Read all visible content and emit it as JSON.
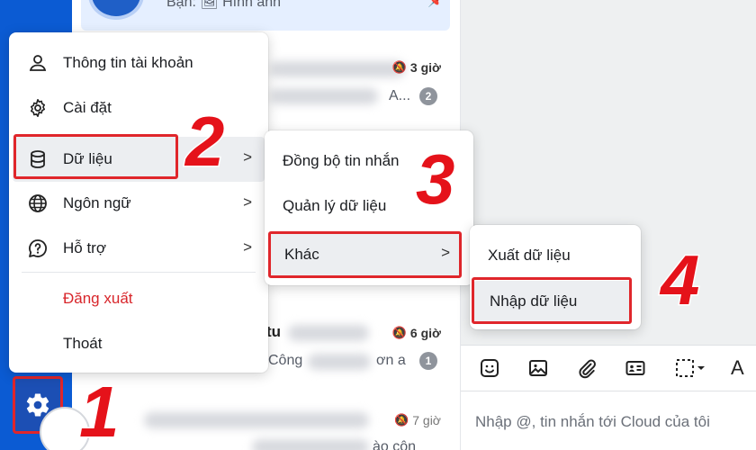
{
  "top_conversation": {
    "preview": "Bạn: 🖼 Hình ảnh",
    "pin_icon": "pin-icon"
  },
  "conversations": [
    {
      "time": "3 giờ",
      "preview": "A...",
      "badge": "2"
    },
    {
      "time": "6 giờ",
      "name_fragment": "tu",
      "preview": "Công",
      "preview_tail": "ơn a",
      "badge": "1"
    },
    {
      "time": "7 giờ",
      "preview": "ào côn"
    }
  ],
  "settings_menu": {
    "items": [
      {
        "label": "Thông tin tài khoản",
        "icon": "user-icon",
        "has_submenu": false
      },
      {
        "label": "Cài đặt",
        "icon": "gear-icon",
        "has_submenu": false
      },
      {
        "label": "Dữ liệu",
        "icon": "database-icon",
        "has_submenu": true,
        "active": true
      },
      {
        "label": "Ngôn ngữ",
        "icon": "globe-icon",
        "has_submenu": true
      },
      {
        "label": "Hỗ trợ",
        "icon": "help-icon",
        "has_submenu": true
      }
    ],
    "logout_label": "Đăng xuất",
    "exit_label": "Thoát"
  },
  "data_submenu": {
    "items": [
      {
        "label": "Đồng bộ tin nhắn"
      },
      {
        "label": "Quản lý dữ liệu"
      },
      {
        "label": "Khác",
        "has_submenu": true,
        "active": true
      }
    ]
  },
  "other_submenu": {
    "items": [
      {
        "label": "Xuất dữ liệu"
      },
      {
        "label": "Nhập dữ liệu",
        "active": true
      }
    ]
  },
  "chat": {
    "input_placeholder": "Nhập @, tin nhắn tới Cloud của tôi",
    "toolbar": [
      "sticker-icon",
      "image-icon",
      "attachment-icon",
      "contact-card-icon",
      "screenshot-icon",
      "text-format-icon"
    ]
  },
  "steps": [
    "1",
    "2",
    "3",
    "4"
  ],
  "colors": {
    "rail": "#0b5bd3",
    "highlight": "#e0262b",
    "logout": "#d8262b",
    "step": "#e5121a"
  }
}
